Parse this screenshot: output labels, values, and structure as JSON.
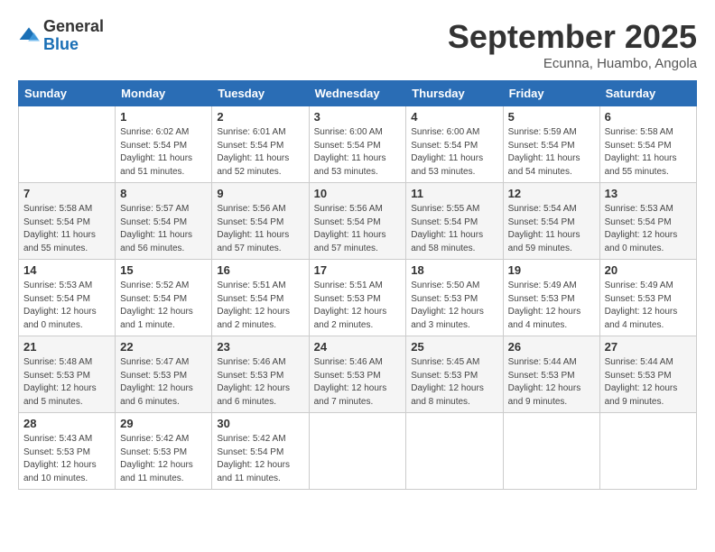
{
  "header": {
    "logo_general": "General",
    "logo_blue": "Blue",
    "month_title": "September 2025",
    "location": "Ecunna, Huambo, Angola"
  },
  "weekdays": [
    "Sunday",
    "Monday",
    "Tuesday",
    "Wednesday",
    "Thursday",
    "Friday",
    "Saturday"
  ],
  "weeks": [
    [
      {
        "day": "",
        "info": ""
      },
      {
        "day": "1",
        "info": "Sunrise: 6:02 AM\nSunset: 5:54 PM\nDaylight: 11 hours\nand 51 minutes."
      },
      {
        "day": "2",
        "info": "Sunrise: 6:01 AM\nSunset: 5:54 PM\nDaylight: 11 hours\nand 52 minutes."
      },
      {
        "day": "3",
        "info": "Sunrise: 6:00 AM\nSunset: 5:54 PM\nDaylight: 11 hours\nand 53 minutes."
      },
      {
        "day": "4",
        "info": "Sunrise: 6:00 AM\nSunset: 5:54 PM\nDaylight: 11 hours\nand 53 minutes."
      },
      {
        "day": "5",
        "info": "Sunrise: 5:59 AM\nSunset: 5:54 PM\nDaylight: 11 hours\nand 54 minutes."
      },
      {
        "day": "6",
        "info": "Sunrise: 5:58 AM\nSunset: 5:54 PM\nDaylight: 11 hours\nand 55 minutes."
      }
    ],
    [
      {
        "day": "7",
        "info": "Sunrise: 5:58 AM\nSunset: 5:54 PM\nDaylight: 11 hours\nand 55 minutes."
      },
      {
        "day": "8",
        "info": "Sunrise: 5:57 AM\nSunset: 5:54 PM\nDaylight: 11 hours\nand 56 minutes."
      },
      {
        "day": "9",
        "info": "Sunrise: 5:56 AM\nSunset: 5:54 PM\nDaylight: 11 hours\nand 57 minutes."
      },
      {
        "day": "10",
        "info": "Sunrise: 5:56 AM\nSunset: 5:54 PM\nDaylight: 11 hours\nand 57 minutes."
      },
      {
        "day": "11",
        "info": "Sunrise: 5:55 AM\nSunset: 5:54 PM\nDaylight: 11 hours\nand 58 minutes."
      },
      {
        "day": "12",
        "info": "Sunrise: 5:54 AM\nSunset: 5:54 PM\nDaylight: 11 hours\nand 59 minutes."
      },
      {
        "day": "13",
        "info": "Sunrise: 5:53 AM\nSunset: 5:54 PM\nDaylight: 12 hours\nand 0 minutes."
      }
    ],
    [
      {
        "day": "14",
        "info": "Sunrise: 5:53 AM\nSunset: 5:54 PM\nDaylight: 12 hours\nand 0 minutes."
      },
      {
        "day": "15",
        "info": "Sunrise: 5:52 AM\nSunset: 5:54 PM\nDaylight: 12 hours\nand 1 minute."
      },
      {
        "day": "16",
        "info": "Sunrise: 5:51 AM\nSunset: 5:54 PM\nDaylight: 12 hours\nand 2 minutes."
      },
      {
        "day": "17",
        "info": "Sunrise: 5:51 AM\nSunset: 5:53 PM\nDaylight: 12 hours\nand 2 minutes."
      },
      {
        "day": "18",
        "info": "Sunrise: 5:50 AM\nSunset: 5:53 PM\nDaylight: 12 hours\nand 3 minutes."
      },
      {
        "day": "19",
        "info": "Sunrise: 5:49 AM\nSunset: 5:53 PM\nDaylight: 12 hours\nand 4 minutes."
      },
      {
        "day": "20",
        "info": "Sunrise: 5:49 AM\nSunset: 5:53 PM\nDaylight: 12 hours\nand 4 minutes."
      }
    ],
    [
      {
        "day": "21",
        "info": "Sunrise: 5:48 AM\nSunset: 5:53 PM\nDaylight: 12 hours\nand 5 minutes."
      },
      {
        "day": "22",
        "info": "Sunrise: 5:47 AM\nSunset: 5:53 PM\nDaylight: 12 hours\nand 6 minutes."
      },
      {
        "day": "23",
        "info": "Sunrise: 5:46 AM\nSunset: 5:53 PM\nDaylight: 12 hours\nand 6 minutes."
      },
      {
        "day": "24",
        "info": "Sunrise: 5:46 AM\nSunset: 5:53 PM\nDaylight: 12 hours\nand 7 minutes."
      },
      {
        "day": "25",
        "info": "Sunrise: 5:45 AM\nSunset: 5:53 PM\nDaylight: 12 hours\nand 8 minutes."
      },
      {
        "day": "26",
        "info": "Sunrise: 5:44 AM\nSunset: 5:53 PM\nDaylight: 12 hours\nand 9 minutes."
      },
      {
        "day": "27",
        "info": "Sunrise: 5:44 AM\nSunset: 5:53 PM\nDaylight: 12 hours\nand 9 minutes."
      }
    ],
    [
      {
        "day": "28",
        "info": "Sunrise: 5:43 AM\nSunset: 5:53 PM\nDaylight: 12 hours\nand 10 minutes."
      },
      {
        "day": "29",
        "info": "Sunrise: 5:42 AM\nSunset: 5:53 PM\nDaylight: 12 hours\nand 11 minutes."
      },
      {
        "day": "30",
        "info": "Sunrise: 5:42 AM\nSunset: 5:54 PM\nDaylight: 12 hours\nand 11 minutes."
      },
      {
        "day": "",
        "info": ""
      },
      {
        "day": "",
        "info": ""
      },
      {
        "day": "",
        "info": ""
      },
      {
        "day": "",
        "info": ""
      }
    ]
  ]
}
